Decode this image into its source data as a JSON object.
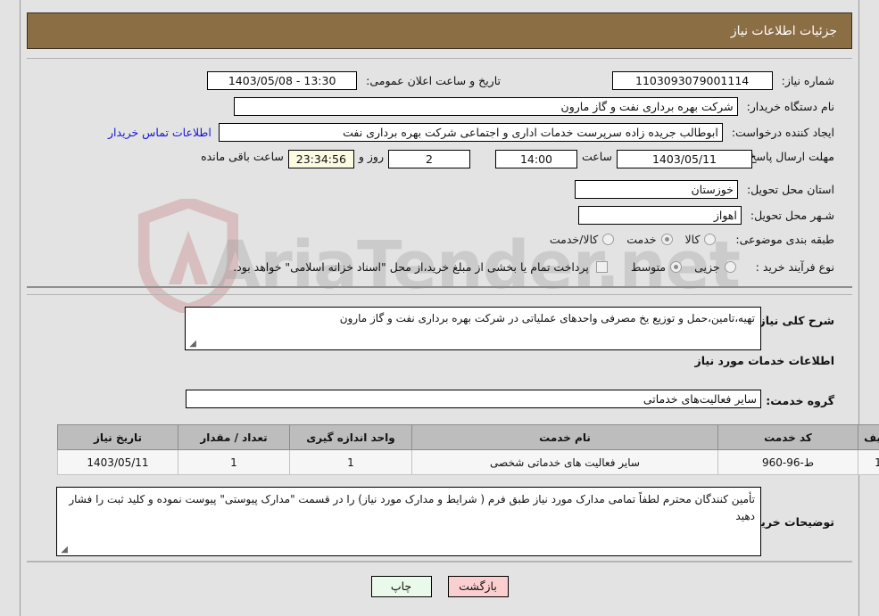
{
  "header": {
    "title": "جزئیات اطلاعات نیاز"
  },
  "top_form": {
    "need_number_label": "شماره نیاز:",
    "need_number_value": "1103093079001114",
    "announce_datetime_label": "تاریخ و ساعت اعلان عمومی:",
    "announce_datetime_value": "13:30 - 1403/05/08",
    "buyer_org_label": "نام دستگاه خریدار:",
    "buyer_org_value": "شرکت بهره برداری نفت و گاز مارون",
    "requester_label": "ایجاد کننده درخواست:",
    "requester_value": "ابوطالب جریده زاده سرپرست خدمات اداری و اجتماعی شرکت بهره برداری نفت",
    "contact_link": "اطلاعات تماس خریدار",
    "deadline_label": "مهلت ارسال پاسخ: تا تاریخ:",
    "deadline_date": "1403/05/11",
    "hour_label": "ساعت",
    "deadline_time": "14:00",
    "days_value": "2",
    "days_label": "روز و",
    "countdown_value": "23:34:56",
    "remaining_label": "ساعت باقی مانده",
    "province_label": "استان محل تحویل:",
    "province_value": "خوزستان",
    "city_label": "شـهر محل تحویل:",
    "city_value": "اهواز",
    "category_label": "طبقه بندی موضوعی:",
    "category_options": [
      {
        "label": "کالا",
        "selected": false
      },
      {
        "label": "خدمت",
        "selected": true
      },
      {
        "label": "کالا/خدمت",
        "selected": false
      }
    ],
    "process_label": "نوع فرآیند خرید :",
    "process_options": [
      {
        "label": "جزیی",
        "selected": false
      },
      {
        "label": "متوسط",
        "selected": true
      }
    ],
    "treasury_note": "پرداخت تمام یا بخشی از مبلغ خرید،از محل \"اسناد خزانه اسلامی\" خواهد بود."
  },
  "description": {
    "general_label": "شرح کلی نیاز:",
    "general_value": "تهیه،تامین،حمل و توزیع یخ مصرفی واحدهای عملیاتی در شرکت بهره برداری  نفت و گاز مارون",
    "services_heading": "اطلاعات خدمات مورد نیاز",
    "service_group_label": "گروه خدمت:",
    "service_group_value": "سایر فعالیت‌های خدماتی"
  },
  "table": {
    "columns": [
      "ردیف",
      "کد خدمت",
      "نام خدمت",
      "واحد اندازه گیری",
      "تعداد / مقدار",
      "تاریخ نیاز"
    ],
    "rows": [
      {
        "row_no": "1",
        "service_code": "ط-96-960",
        "service_name": "سایر فعالیت های خدماتی شخصی",
        "unit": "1",
        "quantity": "1",
        "need_date": "1403/05/11"
      }
    ]
  },
  "buyer_notes": {
    "label": "توضیحات خریدار:",
    "value": "تأمین کنندگان محترم لطفاً تمامی مدارک مورد نیاز طبق فرم ( شرایط و مدارک مورد نیاز) را در قسمت \"مدارک پیوستی\" پیوست نموده و کلید ثبت را فشار دهید"
  },
  "footer": {
    "print_label": "چاپ",
    "back_label": "بازگشت"
  },
  "watermark": {
    "text": "AriaTender.net"
  },
  "colors": {
    "header_band": "#8c6e45",
    "page_bg": "#e3e3e3",
    "link": "#1414d8",
    "countdown_bg": "#fdfce2",
    "print_btn": "#eafaea",
    "back_btn": "#fbcfcf",
    "table_header": "#bdbdbd"
  }
}
